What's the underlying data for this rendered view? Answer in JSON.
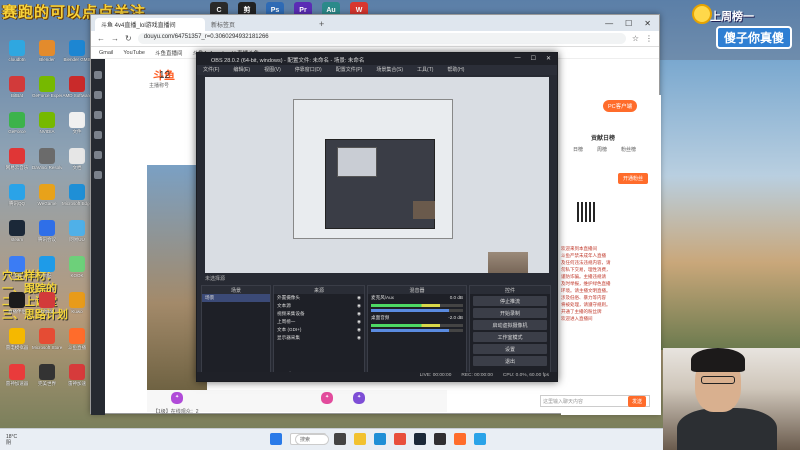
{
  "overlay": {
    "title": "赛跑的可以点点关注",
    "left_text_1": "穴宝样材：",
    "left_text_2": "一、跟踪的",
    "left_text_3": "二、上课堂",
    "left_text_4": "三、思路计划",
    "badge_line1": "上周榜一",
    "badge_line2": "傻子你真傻"
  },
  "desktop_icons": [
    {
      "label": "cloudbtn",
      "color": "#2fa7e0"
    },
    {
      "label": "Blender",
      "color": "#e38b2c"
    },
    {
      "label": "Blender GMS",
      "color": "#1d86d2"
    },
    {
      "label": "BitBat",
      "color": "#d23a3a"
    },
    {
      "label": "GeForce Experience",
      "color": "#76b900"
    },
    {
      "label": "AMD Software",
      "color": "#c92a2a"
    },
    {
      "label": "GeForce",
      "color": "#3cb34b"
    },
    {
      "label": "NVIDIA",
      "color": "#76b900"
    },
    {
      "label": "文件",
      "color": "#f0f0f0"
    },
    {
      "label": "网易云音乐",
      "color": "#e03636"
    },
    {
      "label": "DaVinci Resolve",
      "color": "#6b6b6b"
    },
    {
      "label": "文档",
      "color": "#e6e6e6"
    },
    {
      "label": "腾讯QQ",
      "color": "#2aa3e8"
    },
    {
      "label": "WeGame",
      "color": "#e8a21a"
    },
    {
      "label": "Microsoft Edge",
      "color": "#1f8fd6"
    },
    {
      "label": "steam",
      "color": "#1b2838"
    },
    {
      "label": "腾讯会议",
      "color": "#2f6fe8"
    },
    {
      "label": "网易UU",
      "color": "#4fb0e8"
    },
    {
      "label": "飞书",
      "color": "#3b7cf4"
    },
    {
      "label": "优酷",
      "color": "#1e9be8"
    },
    {
      "label": "KOOK",
      "color": "#6dd07a"
    },
    {
      "label": "直播伴侣",
      "color": "#1c1c1c"
    },
    {
      "label": "BitBat",
      "color": "#d23a3a"
    },
    {
      "label": "Kuwo",
      "color": "#e89b1a"
    },
    {
      "label": "雷电模拟器",
      "color": "#f5b800"
    },
    {
      "label": "Microsoft Store",
      "color": "#e54c34"
    },
    {
      "label": "斗鱼直播",
      "color": "#ff6c2b"
    },
    {
      "label": "雷神加速器",
      "color": "#e93b3b"
    },
    {
      "label": "完美世界",
      "color": "#333"
    },
    {
      "label": "雷神加速",
      "color": "#d63b3b"
    }
  ],
  "topbar_icons": [
    {
      "label": "C",
      "color": "#2a2a2a"
    },
    {
      "label": "剪",
      "color": "#222"
    },
    {
      "label": "Ps",
      "color": "#2f6bb5"
    },
    {
      "label": "Pr",
      "color": "#5b2cb5"
    },
    {
      "label": "Au",
      "color": "#2b8a8a"
    },
    {
      "label": "W",
      "color": "#d9362f"
    }
  ],
  "browser": {
    "tab1": "斗鱼 4v4直播_lol游戏直播间",
    "tab2": "新标签页",
    "url": "douyu.com/64751357_r=0.3060294932181266",
    "bookmarks": [
      "Gmail",
      "YouTube",
      "斗鱼直播间",
      "斗鱼4v4",
      "bunkk直播斗鱼"
    ]
  },
  "douyu": {
    "logo": "斗鱼",
    "count": "12",
    "category": "主播称号",
    "pc_button": "PC客户端",
    "rank_title": "贡献日榜",
    "rank_tabs": [
      "日榜",
      "周榜",
      "粉丝榜"
    ],
    "open_button": "开通粉丝",
    "chat_lines": [
      "欢迎来到本直播间",
      "斗鱼严禁未成年人直播",
      "及任何违法违规内容，请",
      "勿私下交易，理性消费，",
      "谨防诈骗。主播违规请",
      "及时举报，维护绿色直播",
      "环境。请主播文明直播。",
      "涉及低俗、暴力等内容",
      "将被处理，请遵守规则。",
      "开通了主播的粉丝牌",
      "欢迎进入直播间"
    ],
    "chat_placeholder": "这里输入聊天内容",
    "send_label": "发送",
    "fans_text": "【1级】在线观众：2"
  },
  "obs": {
    "title": "OBS 28.0.2 (64-bit, windows) - 配置文件: 未命名 - 场景: 未命名",
    "menu": [
      "文件(F)",
      "编辑(E)",
      "视图(V)",
      "停靠窗口(D)",
      "配置文件(P)",
      "场景集合(S)",
      "工具(T)",
      "帮助(H)"
    ],
    "scene_label": "未选择源",
    "docks": {
      "scenes": {
        "title": "场景",
        "items": [
          "场景"
        ]
      },
      "sources": {
        "title": "来源",
        "items": [
          "外置摄像头",
          "文本源",
          "视频采集设备",
          "上周榜一",
          "文本 (GDI+)",
          "显示器采集"
        ]
      },
      "mixer": {
        "title": "混音器",
        "items": [
          {
            "name": "麦克风/Aux",
            "db": "0.0 dB"
          },
          {
            "name": "桌面音频",
            "db": "-2.0 dB"
          }
        ]
      },
      "controls": {
        "title": "控件",
        "buttons": [
          "停止推流",
          "开始录制",
          "启动虚拟摄像机",
          "工作室模式",
          "设置",
          "退出"
        ]
      }
    },
    "status": [
      "LIVE: 00:00:00",
      "REC: 00:00:00",
      "CPU: 0.0%, 60.00 fps"
    ]
  },
  "taskbar": {
    "weather_temp": "18°C",
    "weather_desc": "阴",
    "search": "搜索"
  }
}
